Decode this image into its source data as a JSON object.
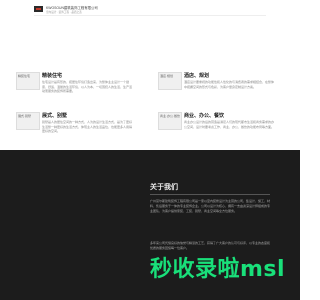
{
  "header": {
    "brand_name": "KWOSOUN建筑装饰工程有限公司",
    "brand_tagline": "室内设计 · 装饰工程 · 品质之选"
  },
  "services": [
    {
      "image_alt": "精装住宅",
      "title": "精装住宅",
      "desc": "住宅设计是有形的，把居住环境打造出来，为整体业主设计一个健康、舒适、温馨的生活环境，以人为本，一切围绕人的生活，生产活动而服务的装饰所需要。"
    },
    {
      "image_alt": "酒店·规划",
      "title": "酒店、规划",
      "desc": "酒店设计要重视的功能性和人性化的与消费者的需求相结合，在整体中把握空间的形式与色彩，为客户量身定制设计方案。"
    },
    {
      "image_alt": "展式·别墅",
      "title": "展式、别墅",
      "desc": "别墅是人的居住空间的一种方式，人为的设计生活方式，是为了更好生活整一种更好的生活方式，体现主人的生活品位，也能更多人用得更好的空间。"
    },
    {
      "image_alt": "商业·办公·餐饮",
      "title": "商业、办公、餐饮",
      "desc": "商业办公设计的后的营造是满足人们的现代都市生活和商务需求的办公空间，设计时要考虑工作、商业、办公、餐饮的功能布局等方面。"
    }
  ],
  "about": {
    "title": "关于我们",
    "paragraph_1": "广州富尔斯建筑装饰工程有限公司是一家以室内装修设计为主营的公司，集设计、施工、材料、售后服务于一体的专业装饰企业。公司以设计为核心，拥有一支由资深设计师组成的专业团队，为客户提供家装、工装、别墅、商业空间等全方位服务。",
    "paragraph_2": "多年来公司凭借良好的信誉与精湛的工艺，获得了广大客户的认可与好评，以专业的态度和优质的服务回馈每一位客户。",
    "watermark": "秒收录啦msl"
  }
}
